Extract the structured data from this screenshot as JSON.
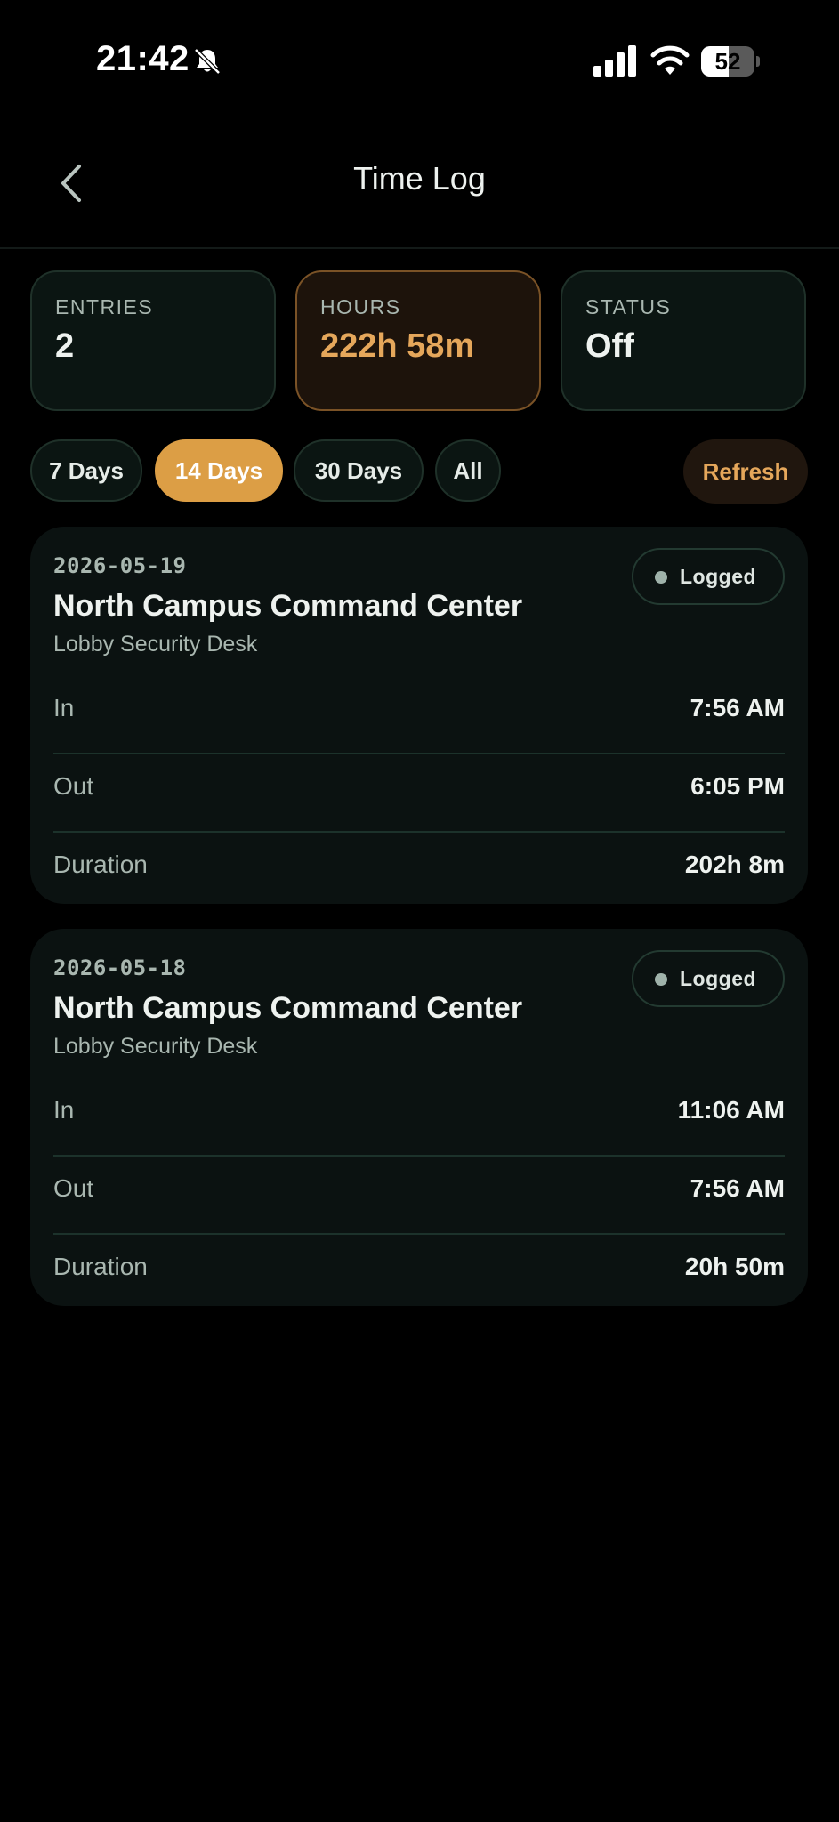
{
  "status_bar": {
    "time": "21:42",
    "battery_level": "52",
    "battery_fraction": 0.52,
    "icons": [
      "bell-slash-icon",
      "cellular-signal-icon",
      "wifi-icon",
      "battery-icon"
    ]
  },
  "header": {
    "title": "Time Log",
    "back_icon": "chevron-left-icon"
  },
  "summary": {
    "entries": {
      "label": "ENTRIES",
      "value": "2"
    },
    "hours": {
      "label": "HOURS",
      "value": "222h 58m"
    },
    "status": {
      "label": "STATUS",
      "value": "Off"
    }
  },
  "filters": {
    "options": [
      {
        "label": "7 Days",
        "active": false
      },
      {
        "label": "14 Days",
        "active": true
      },
      {
        "label": "30 Days",
        "active": false
      },
      {
        "label": "All",
        "active": false
      }
    ],
    "refresh_label": "Refresh"
  },
  "entries": [
    {
      "date": "2026-05-19",
      "badge": "Logged",
      "site": "North Campus Command Center",
      "post": "Lobby Security Desk",
      "rows": [
        {
          "label": "In",
          "value": "7:56 AM"
        },
        {
          "label": "Out",
          "value": "6:05 PM"
        },
        {
          "label": "Duration",
          "value": "202h 8m"
        }
      ]
    },
    {
      "date": "2026-05-18",
      "badge": "Logged",
      "site": "North Campus Command Center",
      "post": "Lobby Security Desk",
      "rows": [
        {
          "label": "In",
          "value": "11:06 AM"
        },
        {
          "label": "Out",
          "value": "7:56 AM"
        },
        {
          "label": "Duration",
          "value": "20h 50m"
        }
      ]
    }
  ],
  "colors": {
    "background": "#000000",
    "card": "#0b1211",
    "accent": "#dc9e45",
    "accent_text": "#e5a75b",
    "muted_text": "#a9b7b0"
  }
}
